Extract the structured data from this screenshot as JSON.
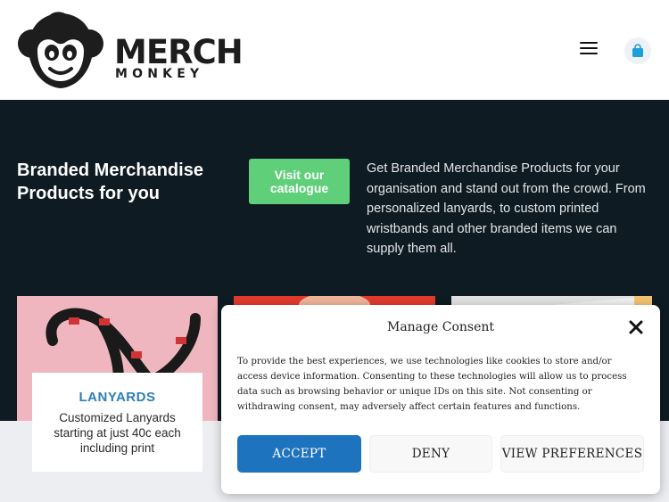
{
  "header": {
    "logo": {
      "word1": "MERCH",
      "word2": "MONKEY",
      "icon": "monkey-logo-icon"
    },
    "menu_icon": "hamburger-menu-icon",
    "cart_icon": "shopping-bag-icon"
  },
  "hero": {
    "title": "Branded Merchandise Products for you",
    "cta_label": "Visit our catalogue",
    "description": "Get Branded Merchandise Products for your organisation and stand out from the crowd. From personalized lanyards, to custom printed wristbands and other branded items we can supply them all."
  },
  "products": [
    {
      "title": "LANYARDS",
      "description": "Customized Lanyards starting at just 40c each including print"
    }
  ],
  "consent": {
    "title": "Manage Consent",
    "text": "To provide the best experiences, we use technologies like cookies to store and/or access device information. Consenting to these technologies will allow us to process data such as browsing behavior or unique IDs on this site. Not consenting or withdrawing consent, may adversely affect certain features and functions.",
    "accept_label": "ACCEPT",
    "deny_label": "DENY",
    "preferences_label": "VIEW PREFERENCES",
    "close_icon": "close-icon"
  },
  "colors": {
    "hero_bg": "#0e1b22",
    "cta": "#5fcf7a",
    "accent_blue": "#1e73be",
    "lanyard_title": "#2d7fb5",
    "cart_icon": "#1ba0d8"
  }
}
